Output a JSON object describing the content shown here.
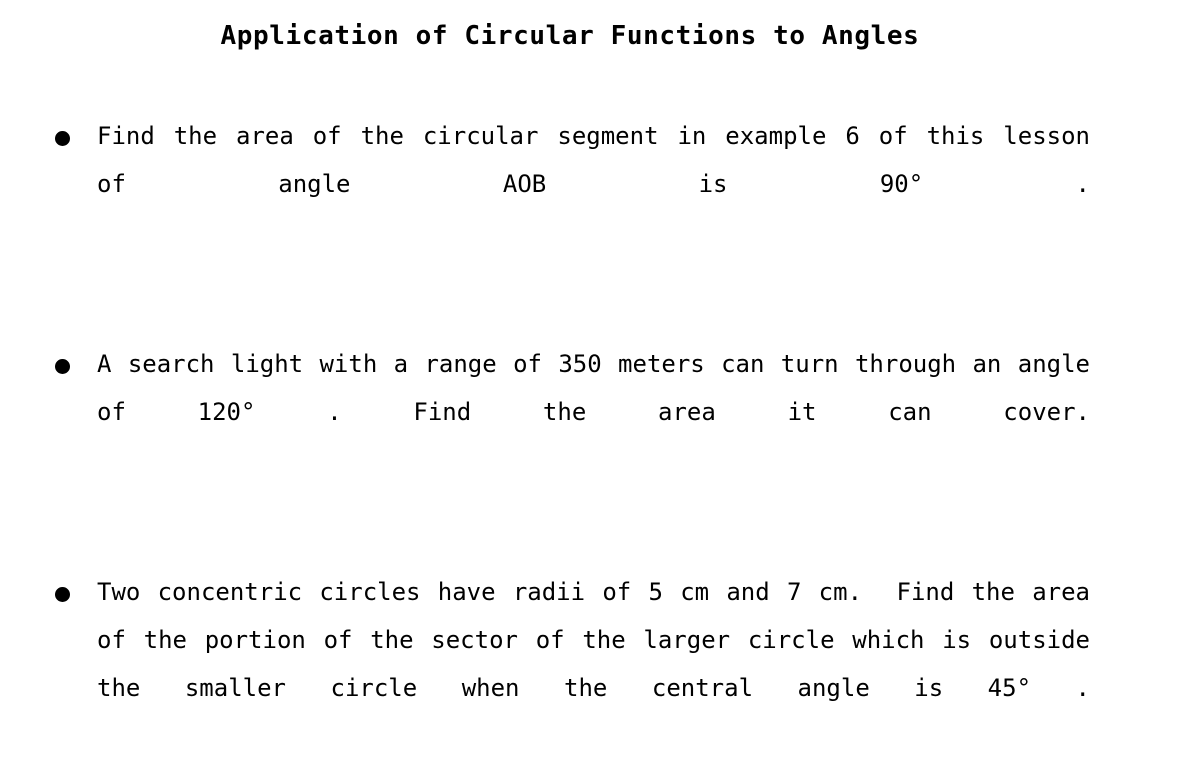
{
  "document": {
    "title": "Application of Circular Functions to Angles",
    "background_color": "#ffffff",
    "text_color": "#000000"
  },
  "bullets": [
    {
      "marker": "filled-circle",
      "text": "Find the area of the circular segment in example 6 of this lesson of angle AOB is 90° ."
    },
    {
      "marker": "filled-circle",
      "text": "A search light with a range of 350 meters can turn through an angle of 120° . Find the area it can cover."
    },
    {
      "marker": "filled-circle",
      "text": "Two concentric circles have radii of 5 cm and 7 cm.  Find the area of the portion of the sector of the larger circle which is outside the smaller circle when the central angle is 45° ."
    }
  ]
}
